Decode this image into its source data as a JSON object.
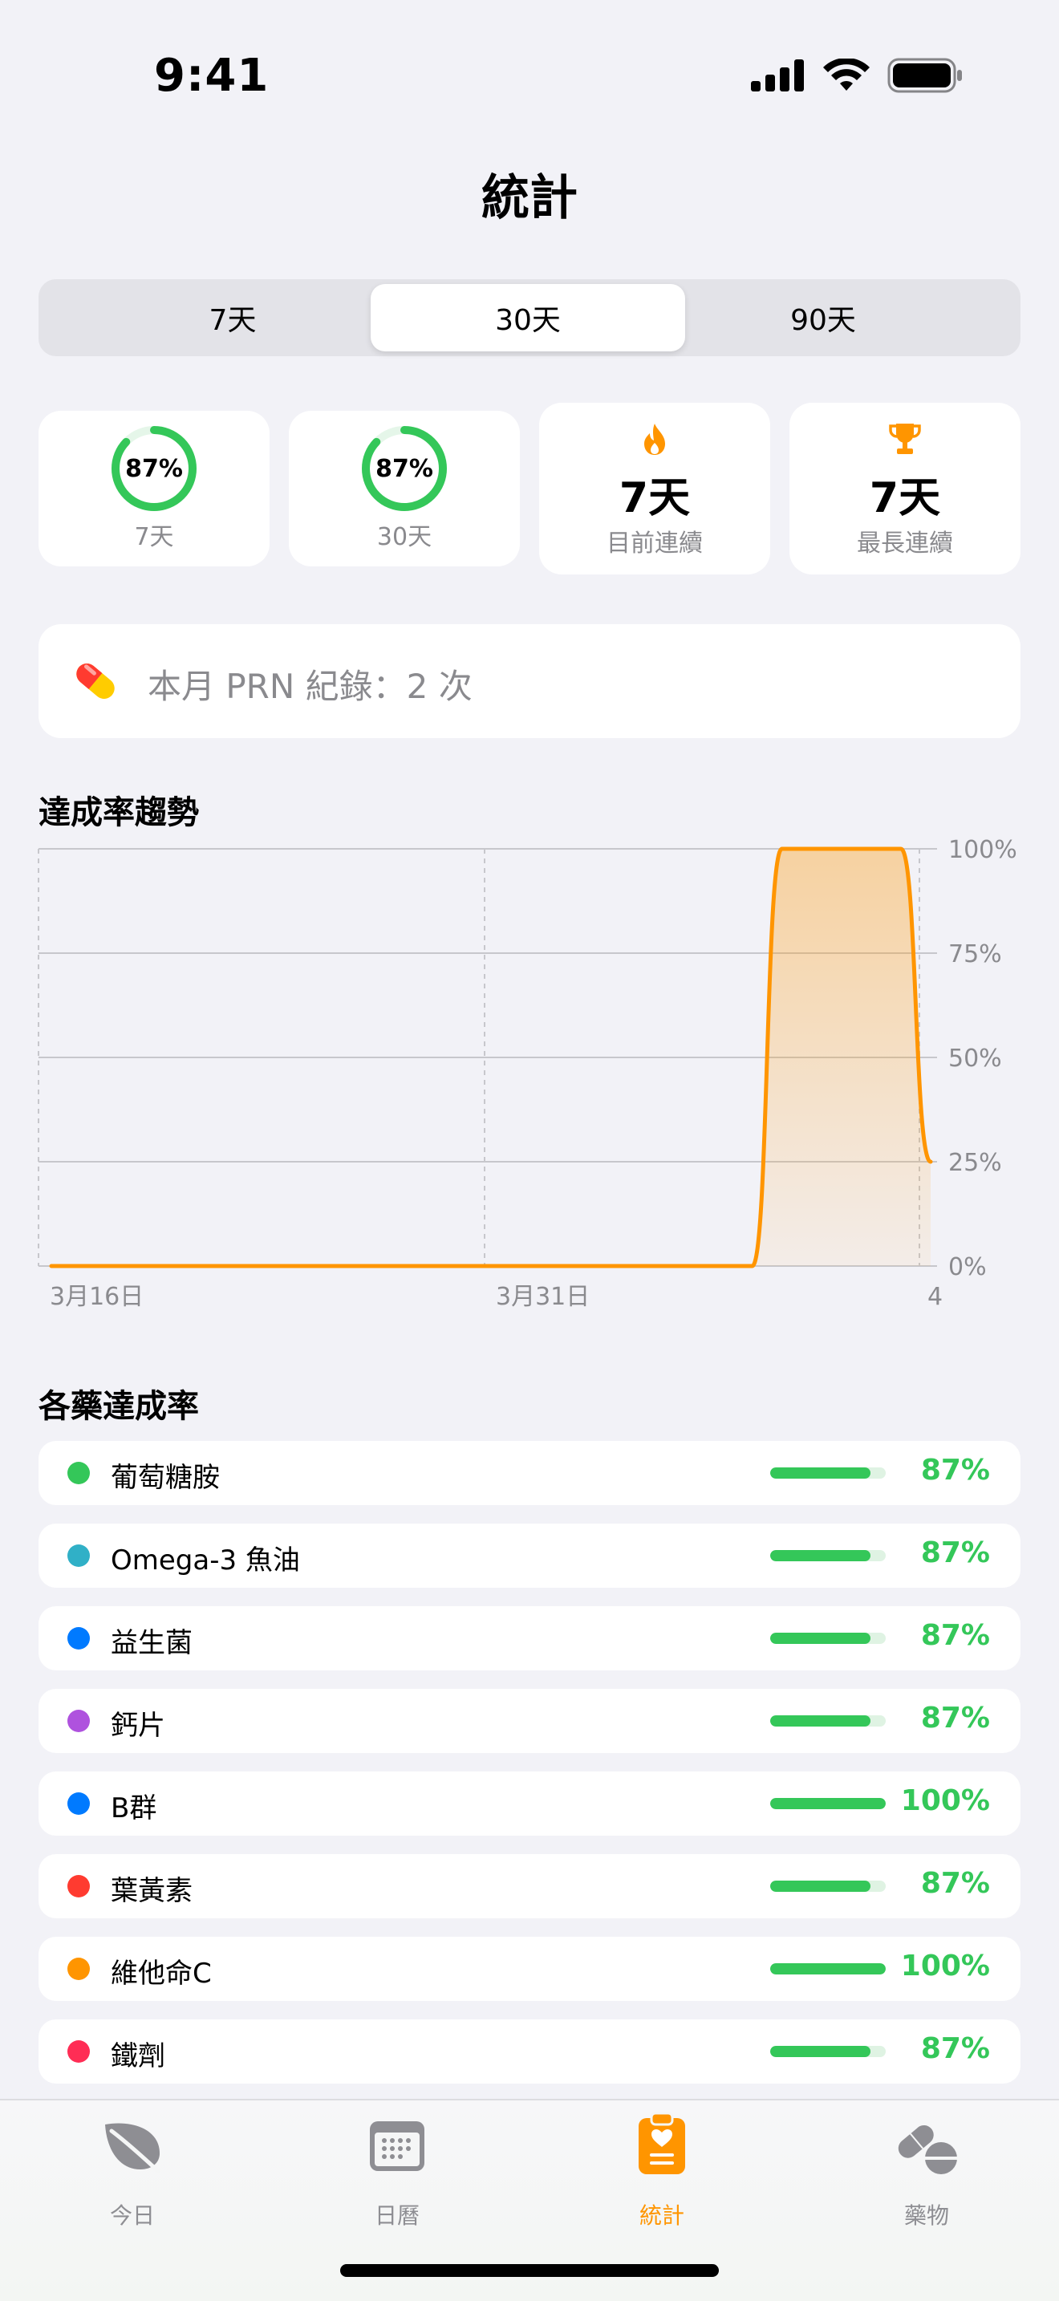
{
  "status_bar": {
    "time": "9:41"
  },
  "header": {
    "title": "統計"
  },
  "segmented": {
    "options": [
      "7天",
      "30天",
      "90天"
    ],
    "selected": "30天"
  },
  "stats": {
    "ring_7": {
      "value": "87%",
      "label": "7天",
      "fraction": 0.87
    },
    "ring_30": {
      "value": "87%",
      "label": "30天",
      "fraction": 0.87
    },
    "current_streak": {
      "value": "7天",
      "label": "目前連續",
      "icon": "flame-icon"
    },
    "longest_streak": {
      "value": "7天",
      "label": "最長連續",
      "icon": "trophy-icon"
    }
  },
  "prn": {
    "text": "本月 PRN 紀錄：2 次",
    "icon": "pill-capsule-icon"
  },
  "trend": {
    "title": "達成率趨勢"
  },
  "chart_data": {
    "type": "area",
    "title": "達成率趨勢",
    "x_labels": [
      "3月16日",
      "3月31日",
      "4"
    ],
    "y_ticks": [
      "100%",
      "75%",
      "50%",
      "25%",
      "0%"
    ],
    "ylim": [
      0,
      100
    ],
    "color": "#ff9500",
    "x": [
      0,
      5,
      10,
      15,
      20,
      24,
      25,
      26,
      27,
      28,
      29,
      30
    ],
    "values": [
      0,
      0,
      0,
      0,
      0,
      0,
      100,
      100,
      100,
      100,
      100,
      25
    ]
  },
  "medications": {
    "title": "各藥達成率",
    "items": [
      {
        "name": "葡萄糖胺",
        "percent": "87%",
        "value": 0.87,
        "color": "#34c759"
      },
      {
        "name": "Omega-3 魚油",
        "percent": "87%",
        "value": 0.87,
        "color": "#30b0c7"
      },
      {
        "name": "益生菌",
        "percent": "87%",
        "value": 0.87,
        "color": "#007aff"
      },
      {
        "name": "鈣片",
        "percent": "87%",
        "value": 0.87,
        "color": "#af52de"
      },
      {
        "name": "B群",
        "percent": "100%",
        "value": 1.0,
        "color": "#007aff"
      },
      {
        "name": "葉黃素",
        "percent": "87%",
        "value": 0.87,
        "color": "#ff3b30"
      },
      {
        "name": "維他命C",
        "percent": "100%",
        "value": 1.0,
        "color": "#ff9500"
      },
      {
        "name": "鐵劑",
        "percent": "87%",
        "value": 0.87,
        "color": "#ff2d55"
      }
    ]
  },
  "tab_bar": {
    "items": [
      {
        "label": "今日",
        "icon": "leaf-icon"
      },
      {
        "label": "日曆",
        "icon": "calendar-icon"
      },
      {
        "label": "統計",
        "icon": "clipboard-heart-icon"
      },
      {
        "label": "藥物",
        "icon": "pills-icon"
      }
    ],
    "active": "統計"
  },
  "colors": {
    "accent": "#ff9500",
    "success": "#34c759",
    "background": "#f2f2f7"
  }
}
